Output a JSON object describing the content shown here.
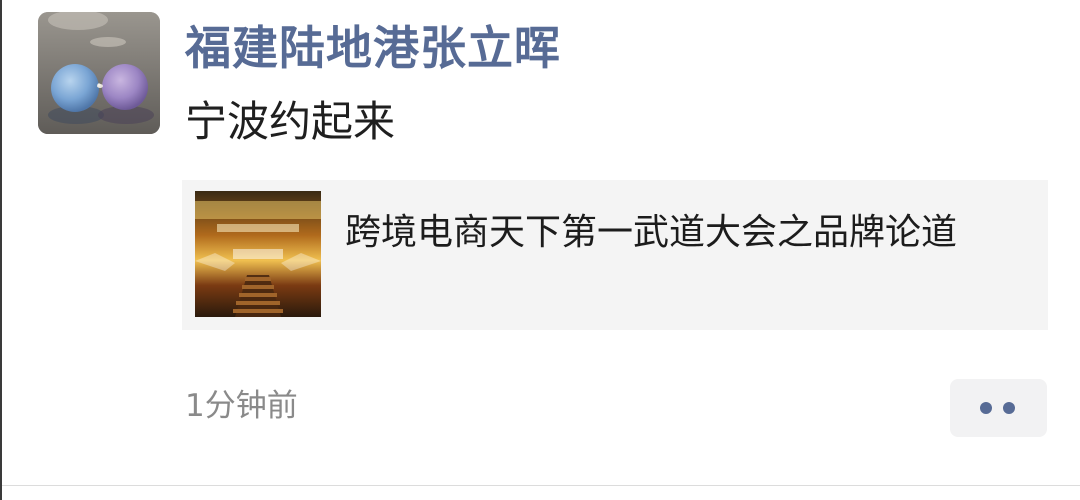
{
  "post": {
    "author_name": "福建陆地港张立晖",
    "text": "宁波约起来",
    "link": {
      "title": "跨境电商天下第一武道大会之品牌论道",
      "thumbnail_icon": "event-banner-image"
    },
    "timestamp": "1分钟前",
    "more_icon": "two-dots-icon",
    "colors": {
      "name": "#576b95",
      "card_bg": "#f4f4f4",
      "timestamp": "#8a8a8a"
    }
  }
}
